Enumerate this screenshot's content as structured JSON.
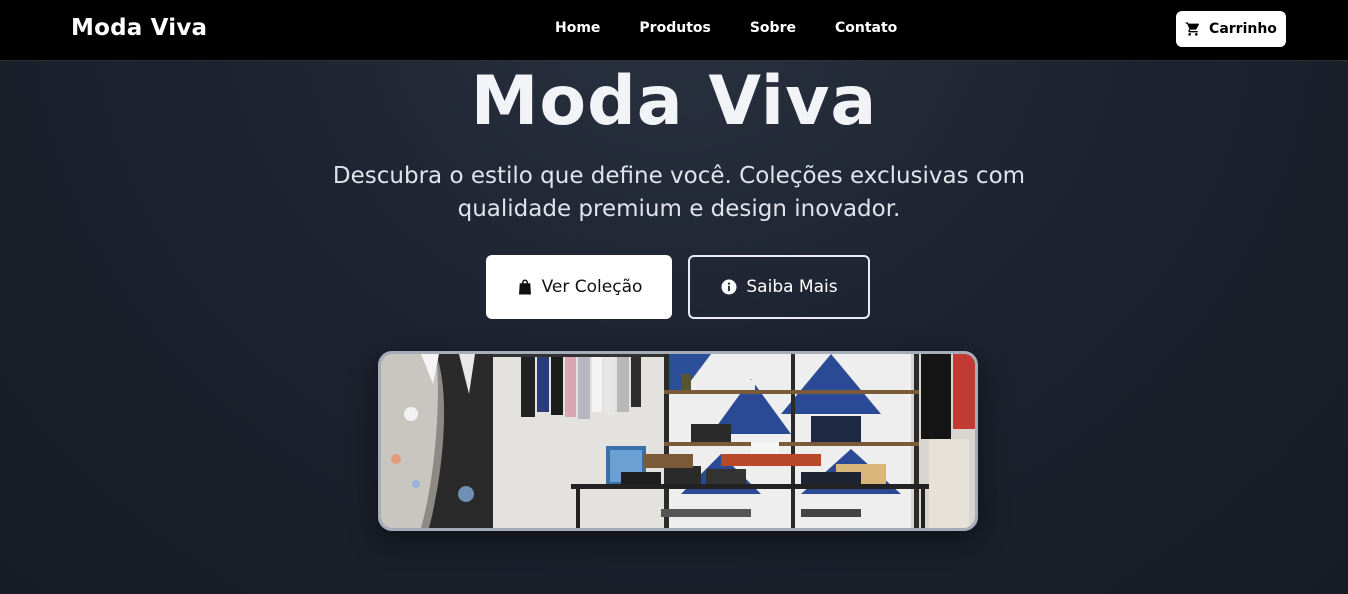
{
  "navbar": {
    "brand": "Moda Viva",
    "links": [
      {
        "label": "Home"
      },
      {
        "label": "Produtos"
      },
      {
        "label": "Sobre"
      },
      {
        "label": "Contato"
      }
    ],
    "cart": {
      "label": "Carrinho",
      "icon": "cart-icon"
    }
  },
  "hero": {
    "title": "Moda Viva",
    "subtitle": "Descubra o estilo que define você. Coleções exclusivas com qualidade premium e design inovador.",
    "primary_button": {
      "label": "Ver Coleção",
      "icon": "shopping-bag-icon"
    },
    "secondary_button": {
      "label": "Saiba Mais",
      "icon": "info-circle-icon"
    }
  },
  "colors": {
    "navbar_bg": "#000000",
    "hero_bg": "#1d2330",
    "primary_button_bg": "#ffffff",
    "text": "#ffffff"
  }
}
